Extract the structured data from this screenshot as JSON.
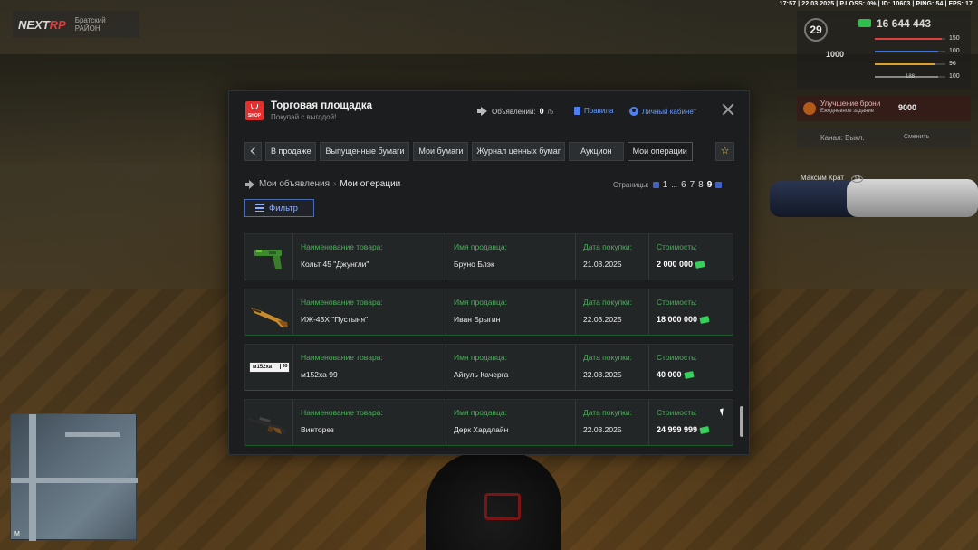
{
  "topbar": {
    "status": "17:57 | 22.03.2025 | P.LOSS: 0% | ID: 10603 | PING: 54 | FPS: 17"
  },
  "logo": {
    "brand_a": "NEXT",
    "brand_b": "RP",
    "server": "Братский",
    "server_sub": "РАЙОН"
  },
  "hud": {
    "level": "29",
    "money": "16 644 443",
    "money2": "1000",
    "stats": [
      {
        "value": "150",
        "color": "#e04040",
        "fill": 0.95
      },
      {
        "value": "100",
        "color": "#3f6fd8",
        "fill": 0.9
      },
      {
        "value": "96",
        "color": "#e0a030",
        "fill": 0.85
      },
      {
        "value": "100",
        "color": "#888888",
        "fill": 0.9
      }
    ],
    "ammo": "188",
    "quest_title": "Улучшение брони",
    "quest_sub": "Ежедневное задание",
    "quest_amount": "9000",
    "radio_label": "Канал: Выкл.",
    "radio_action": "Сменить",
    "player_name": "Максим Крат",
    "player_id": "14"
  },
  "minimap": {
    "label": "M"
  },
  "window": {
    "logo_text": "SHOP",
    "title": "Торговая площадка",
    "subtitle": "Покупай с выгодой!",
    "ads_label": "Объявлений:",
    "ads_count": "0",
    "ads_max": "/5",
    "rules": "Правила",
    "cabinet": "Личный кабинет"
  },
  "nav": {
    "items": [
      {
        "label": "В продаже"
      },
      {
        "label": "Выпущенные бумаги"
      },
      {
        "label": "Мои бумаги"
      },
      {
        "label": "Журнал ценных бумаг"
      },
      {
        "label": "Аукцион"
      },
      {
        "label": "Мои операции"
      }
    ],
    "active": "Мои операции",
    "fav_glyph": "☆"
  },
  "breadcrumb": {
    "parent": "Мои объявления",
    "sep": "›",
    "current": "Мои операции"
  },
  "pagination": {
    "label": "Страницы:",
    "pages": [
      "1",
      "...",
      "6",
      "7",
      "8",
      "9"
    ],
    "current": "9"
  },
  "filter": {
    "label": "Фильтр"
  },
  "labels": {
    "name": "Наименование товара:",
    "seller": "Имя продавца:",
    "date": "Дата покупки:",
    "price": "Стоимость:"
  },
  "rows": [
    {
      "item": "Кольт 45 \"Джунгли\"",
      "seller": "Бруно Блэк",
      "date": "21.03.2025",
      "price": "2 000 000",
      "thumb": "pistol"
    },
    {
      "item": "ИЖ-43Х \"Пустыня\"",
      "seller": "Иван Брыгин",
      "date": "22.03.2025",
      "price": "18 000 000",
      "thumb": "shotgun"
    },
    {
      "item": "м152ха 99",
      "seller": "Айгуль Качерга",
      "date": "22.03.2025",
      "price": "40 000",
      "thumb": "plate",
      "plate_text": "м152ха",
      "plate_region": "99"
    },
    {
      "item": "Винторез",
      "seller": "Дерк Хардлайн",
      "date": "22.03.2025",
      "price": "24 999 999",
      "thumb": "rifle"
    }
  ]
}
